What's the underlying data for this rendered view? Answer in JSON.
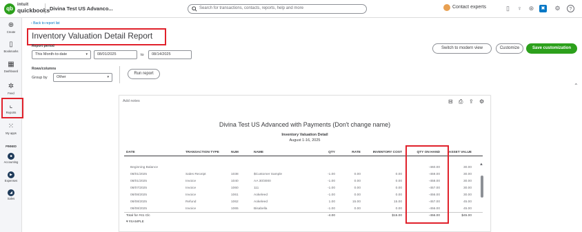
{
  "app": {
    "logo_top": "intuit",
    "logo_bottom": "quickbooks",
    "company": "Divina Test US Advanco..."
  },
  "search": {
    "placeholder": "Search for transactions, contacts, reports, help and more"
  },
  "topbar": {
    "experts_label": "Contact experts"
  },
  "nav": {
    "items": [
      {
        "label": "Create",
        "icon": "plus-circle-icon"
      },
      {
        "label": "Bookmarks",
        "icon": "bookmark-icon"
      },
      {
        "label": "Dashboard",
        "icon": "dashboard-icon"
      },
      {
        "label": "Feed",
        "icon": "feed-icon"
      },
      {
        "label": "Reports",
        "icon": "reports-icon"
      },
      {
        "label": "My apps",
        "icon": "apps-grid-icon"
      }
    ],
    "pinned_label": "PINNED",
    "pinned": [
      {
        "label": "Accounting"
      },
      {
        "label": "Expenses"
      },
      {
        "label": "Sales"
      }
    ]
  },
  "page": {
    "back_link": "Back to report list",
    "title": "Inventory Valuation Detail Report",
    "report_period_label": "Report period",
    "period_value": "This Month-to-date",
    "from_date": "08/01/2025",
    "to_label": "to",
    "to_date": "08/14/2025",
    "rows_columns_label": "Rows/columns",
    "group_by_label": "Group by",
    "group_by_value": "Other",
    "run_report": "Run report",
    "switch_modern": "Switch to modern view",
    "customize": "Customize",
    "save_customization": "Save customization"
  },
  "report": {
    "add_notes": "Add notes",
    "company_title": "Divina Test US Advanced with Payments (Don't change name)",
    "report_name": "Inventory Valuation Detail",
    "date_range": "August 1-16, 2025",
    "columns": [
      "DATE",
      "TRANSACTION TYPE",
      "NUM",
      "NAME",
      "QTY",
      "RATE",
      "INVENTORY COST",
      "QTY ON HAND",
      "ASSET VALUE"
    ],
    "beginning_balance": {
      "label": "Beginning Balance",
      "qty_on_hand": "-460.00",
      "asset_value": "30.00"
    },
    "rows": [
      {
        "date": "08/01/2025",
        "type": "Sales Receipt",
        "num": "1038",
        "name": "$Customer Sample",
        "qty": "-1.00",
        "rate": "0.00",
        "cost": "0.00",
        "qoh": "-459.00",
        "asset": "30.00"
      },
      {
        "date": "08/01/2025",
        "type": "Invoice",
        "num": "1040",
        "name": "AA 30/3000",
        "qty": "-1.00",
        "rate": "0.00",
        "cost": "0.00",
        "qoh": "-458.00",
        "asset": "30.00"
      },
      {
        "date": "08/07/2025",
        "type": "Invoice",
        "num": "1060",
        "name": "111",
        "qty": "-1.00",
        "rate": "0.00",
        "cost": "0.00",
        "qoh": "-457.00",
        "asset": "30.00"
      },
      {
        "date": "08/08/2025",
        "type": "Invoice",
        "num": "1061",
        "name": "Aokeleed",
        "qty": "-1.00",
        "rate": "0.00",
        "cost": "0.00",
        "qoh": "-456.00",
        "asset": "30.00"
      },
      {
        "date": "08/08/2025",
        "type": "Refund",
        "num": "1062",
        "name": "Aokeleed",
        "qty": "1.00",
        "rate": "15.00",
        "cost": "15.00",
        "qoh": "-457.00",
        "asset": "45.00"
      },
      {
        "date": "08/08/2025",
        "type": "Invoice",
        "num": "1065",
        "name": "Bisabella",
        "qty": "-1.00",
        "rate": "0.00",
        "cost": "0.00",
        "qoh": "-456.00",
        "asset": "45.00"
      }
    ],
    "total": {
      "label": "Total for #41 Clc",
      "qty": "-4.00",
      "cost": "$15.00",
      "qoh": "-456.00",
      "asset": "$45.00"
    },
    "next_group": "#SAMPLE"
  }
}
